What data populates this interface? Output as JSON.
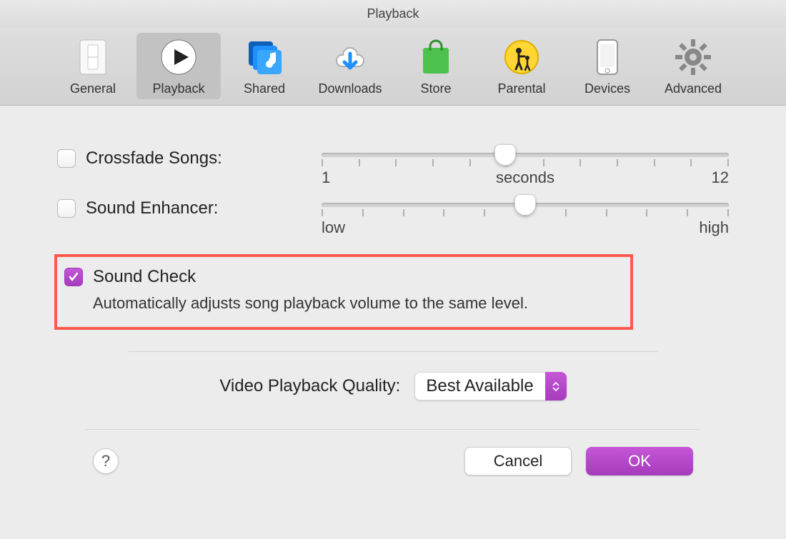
{
  "window_title": "Playback",
  "toolbar": {
    "items": [
      {
        "label": "General"
      },
      {
        "label": "Playback"
      },
      {
        "label": "Shared"
      },
      {
        "label": "Downloads"
      },
      {
        "label": "Store"
      },
      {
        "label": "Parental"
      },
      {
        "label": "Devices"
      },
      {
        "label": "Advanced"
      }
    ],
    "active_index": 1
  },
  "crossfade": {
    "label": "Crossfade Songs:",
    "checked": false,
    "min_label": "1",
    "center_label": "seconds",
    "max_label": "12",
    "value_percent": 45
  },
  "enhancer": {
    "label": "Sound Enhancer:",
    "checked": false,
    "low_label": "low",
    "high_label": "high",
    "value_percent": 50
  },
  "sound_check": {
    "label": "Sound Check",
    "checked": true,
    "description": "Automatically adjusts song playback volume to the same level."
  },
  "video_quality": {
    "label": "Video Playback Quality:",
    "selected": "Best Available"
  },
  "footer": {
    "help": "?",
    "cancel": "Cancel",
    "ok": "OK"
  }
}
